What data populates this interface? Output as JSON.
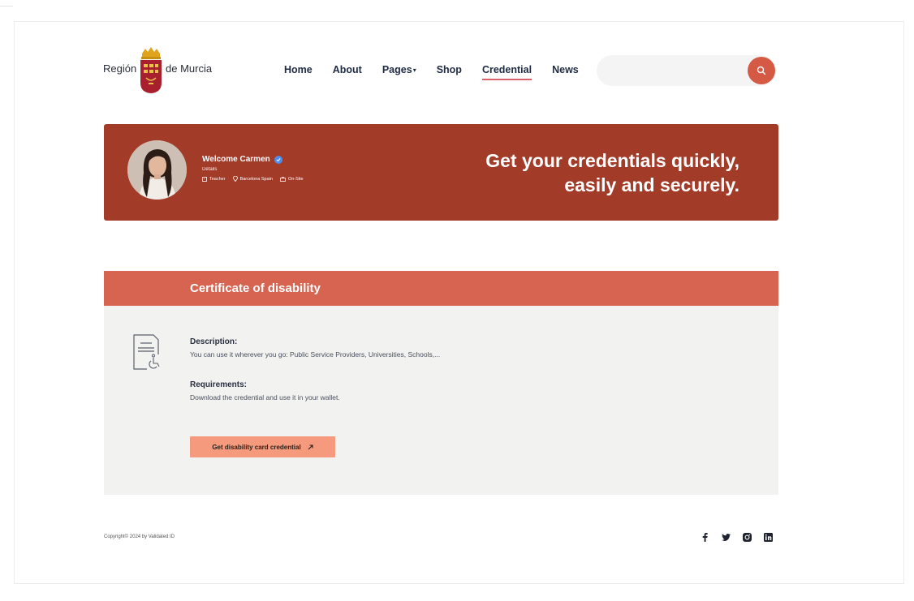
{
  "logo": {
    "left_text": "Región",
    "right_text": "de Murcia"
  },
  "nav": {
    "items": [
      {
        "label": "Home"
      },
      {
        "label": "About"
      },
      {
        "label": "Pages"
      },
      {
        "label": "Shop"
      },
      {
        "label": "Credential"
      },
      {
        "label": "News"
      }
    ],
    "active": "Credential"
  },
  "search": {
    "placeholder": "",
    "icon": "search-icon"
  },
  "hero": {
    "welcome": "Welcome Carmen",
    "details": "Details",
    "meta": {
      "role": "Teacher",
      "location": "Barcelona Spain",
      "mode": "On-Site"
    },
    "tagline_line1": "Get your credentials quickly,",
    "tagline_line2": "easily and securely."
  },
  "certificate": {
    "title": "Certificate of disability",
    "description_label": "Description:",
    "description_text": "You can use it wherever you go: Public Service Providers, Universities, Schools,...",
    "requirements_label": "Requirements:",
    "requirements_text": "Download the credential and use it in your wallet.",
    "cta_label": "Get disability card credential"
  },
  "footer": {
    "copyright": "Copyright© 2024 by Validated ID",
    "social": [
      "facebook-icon",
      "twitter-icon",
      "instagram-icon",
      "linkedin-icon"
    ]
  },
  "colors": {
    "hero_bg": "#a33b29",
    "card_header": "#d76450",
    "cta_bg": "#f59a7c",
    "search_button": "#d45a46",
    "nav_underline": "#d8636a"
  }
}
